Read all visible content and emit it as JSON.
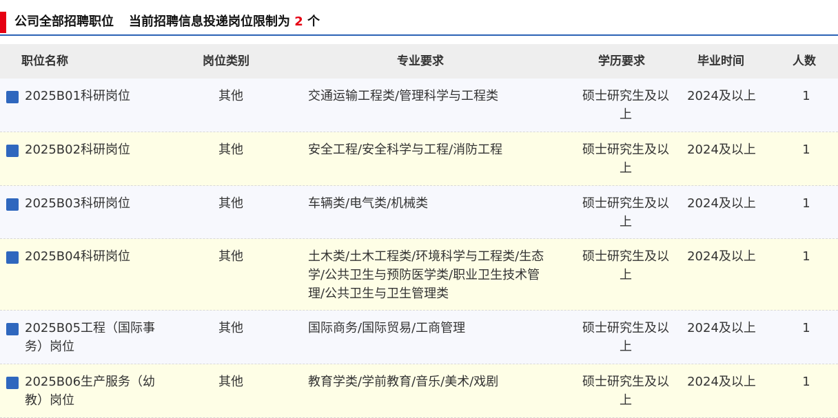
{
  "header": {
    "section_title": "公司全部招聘职位",
    "limit_prefix": "当前招聘信息投递岗位限制为",
    "limit_value": "2",
    "limit_suffix": "个",
    "accent_color": "#e60012",
    "rule_color": "#2b62b5"
  },
  "table": {
    "columns": [
      "职位名称",
      "岗位类别",
      "专业要求",
      "学历要求",
      "毕业时间",
      "人数"
    ],
    "rows": [
      {
        "name": "2025B01科研岗位",
        "type": "其他",
        "major": "交通运输工程类/管理科学与工程类",
        "education": "硕士研究生及以上",
        "graduation": "2024及以上",
        "count": "1"
      },
      {
        "name": "2025B02科研岗位",
        "type": "其他",
        "major": "安全工程/安全科学与工程/消防工程",
        "education": "硕士研究生及以上",
        "graduation": "2024及以上",
        "count": "1"
      },
      {
        "name": "2025B03科研岗位",
        "type": "其他",
        "major": "车辆类/电气类/机械类",
        "education": "硕士研究生及以上",
        "graduation": "2024及以上",
        "count": "1"
      },
      {
        "name": "2025B04科研岗位",
        "type": "其他",
        "major": "土木类/土木工程类/环境科学与工程类/生态学/公共卫生与预防医学类/职业卫生技术管理/公共卫生与卫生管理类",
        "education": "硕士研究生及以上",
        "graduation": "2024及以上",
        "count": "1"
      },
      {
        "name": "2025B05工程（国际事务）岗位",
        "type": "其他",
        "major": "国际商务/国际贸易/工商管理",
        "education": "硕士研究生及以上",
        "graduation": "2024及以上",
        "count": "1"
      },
      {
        "name": "2025B06生产服务（幼教）岗位",
        "type": "其他",
        "major": "教育学类/学前教育/音乐/美术/戏剧",
        "education": "硕士研究生及以上",
        "graduation": "2024及以上",
        "count": "1"
      }
    ],
    "icon": "square-bullet-icon",
    "bullet_color": "#2f67be"
  }
}
